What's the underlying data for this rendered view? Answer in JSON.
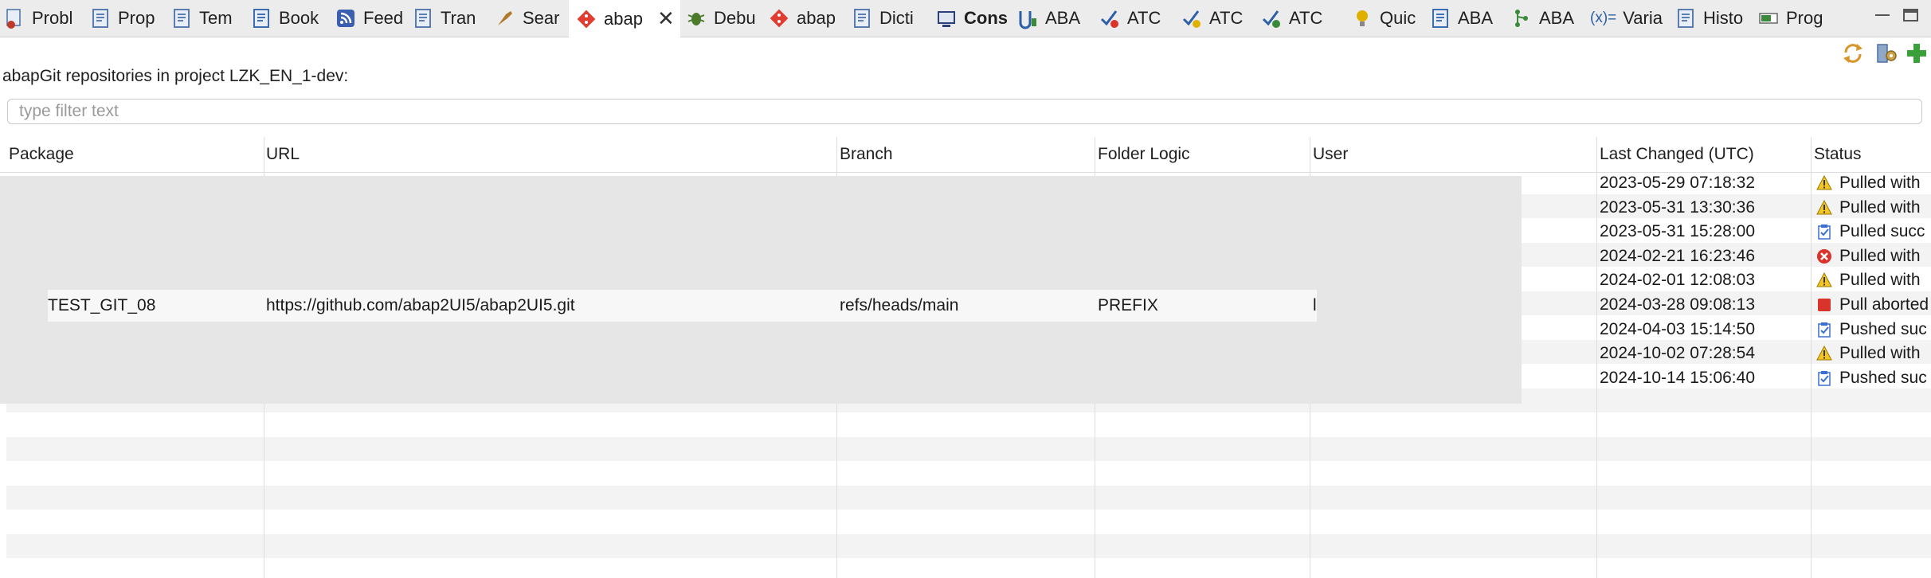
{
  "tabs": [
    {
      "label": "Probl",
      "icon": "problems-icon",
      "color": "#c0392b"
    },
    {
      "label": "Prop",
      "icon": "properties-icon",
      "color": "#4a6fa5"
    },
    {
      "label": "Tem",
      "icon": "templates-icon",
      "color": "#4a6fa5"
    },
    {
      "label": "Book",
      "icon": "bookmarks-icon",
      "color": "#2b5fa8"
    },
    {
      "label": "Feed",
      "icon": "feed-icon",
      "color": "#3b5fb0"
    },
    {
      "label": "Tran",
      "icon": "transport-icon",
      "color": "#4a6fa5"
    },
    {
      "label": "Sear",
      "icon": "search-icon",
      "color": "#b07a2a"
    },
    {
      "label": "abap",
      "icon": "abapgit-icon",
      "color": "#e03c31",
      "active": true,
      "close": "✕"
    },
    {
      "label": "Debu",
      "icon": "debug-icon",
      "color": "#4a7a2a"
    },
    {
      "label": "abap",
      "icon": "abapgit-staging-icon",
      "color": "#e03c31"
    },
    {
      "label": "Dicti",
      "icon": "dictionary-icon",
      "color": "#4a6fa5"
    },
    {
      "label": "Cons",
      "icon": "console-icon",
      "color": "#2b3f7a",
      "bold": true
    },
    {
      "label": "ABA",
      "icon": "abap-unit-icon",
      "color": "#2b5fa8"
    },
    {
      "label": "ATC",
      "icon": "atc-problems-icon",
      "color": "#2b5fa8"
    },
    {
      "label": "ATC",
      "icon": "atc-results-icon",
      "color": "#2b5fa8"
    },
    {
      "label": "ATC",
      "icon": "atc-exemptions-icon",
      "color": "#2b5fa8"
    },
    {
      "label": "Quic",
      "icon": "quick-assist-icon",
      "color": "#e0b000"
    },
    {
      "label": "ABA",
      "icon": "abap-doc-icon",
      "color": "#2b5fa8"
    },
    {
      "label": "ABA",
      "icon": "abap-element-info-icon",
      "color": "#3a8a3a"
    },
    {
      "label": "Varia",
      "icon": "variables-icon",
      "color": "#2b5fa8",
      "glyph": "(x)="
    },
    {
      "label": "Histo",
      "icon": "history-icon",
      "color": "#4a6fa5"
    },
    {
      "label": "Prog",
      "icon": "progress-icon",
      "color": "#3a8a3a"
    }
  ],
  "window_controls": {
    "minimize_icon": "minimize-icon",
    "maximize_icon": "maximize-icon"
  },
  "toolbar": {
    "refresh_icon": "refresh-icon",
    "settings_icon": "repository-settings-icon",
    "add_icon": "add-repository-icon"
  },
  "heading": "abapGit repositories in project LZK_EN_1-dev:",
  "filter": {
    "placeholder": "type filter text",
    "value": ""
  },
  "columns": [
    "Package",
    "URL",
    "Branch",
    "Folder Logic",
    "User",
    "Last Changed (UTC)",
    "Status"
  ],
  "rows": [
    {
      "last_changed": "2023-05-29 07:18:32",
      "status": "Pulled with",
      "status_icon": "warning-icon"
    },
    {
      "last_changed": "2023-05-31 13:30:36",
      "status": "Pulled with",
      "status_icon": "warning-icon"
    },
    {
      "last_changed": "2023-05-31 15:28:00",
      "status": "Pulled succ",
      "status_icon": "success-clipboard-icon"
    },
    {
      "last_changed": "2024-02-21 16:23:46",
      "status": "Pulled with",
      "status_icon": "error-icon"
    },
    {
      "last_changed": "2024-02-01 12:08:03",
      "status": "Pulled with",
      "status_icon": "warning-icon"
    },
    {
      "last_changed": "2024-03-28 09:08:13",
      "status": "Pull aborted",
      "status_icon": "aborted-icon"
    },
    {
      "last_changed": "2024-04-03 15:14:50",
      "status": "Pushed suc",
      "status_icon": "success-clipboard-icon"
    },
    {
      "last_changed": "2024-10-02 07:28:54",
      "status": "Pulled with",
      "status_icon": "warning-icon"
    },
    {
      "last_changed": "2024-10-14 15:06:40",
      "status": "Pushed suc",
      "status_icon": "success-clipboard-icon"
    }
  ],
  "highlighted_row": {
    "package": "TEST_GIT_08",
    "url": "https://github.com/abap2UI5/abap2UI5.git",
    "branch": "refs/heads/main",
    "folder_logic": "PREFIX",
    "user": "l"
  },
  "colors": {
    "warning": "#f3c623",
    "error": "#d9342b",
    "aborted": "#d9342b",
    "success": "#3b6fd1",
    "overlay": "#e6e6e6"
  }
}
